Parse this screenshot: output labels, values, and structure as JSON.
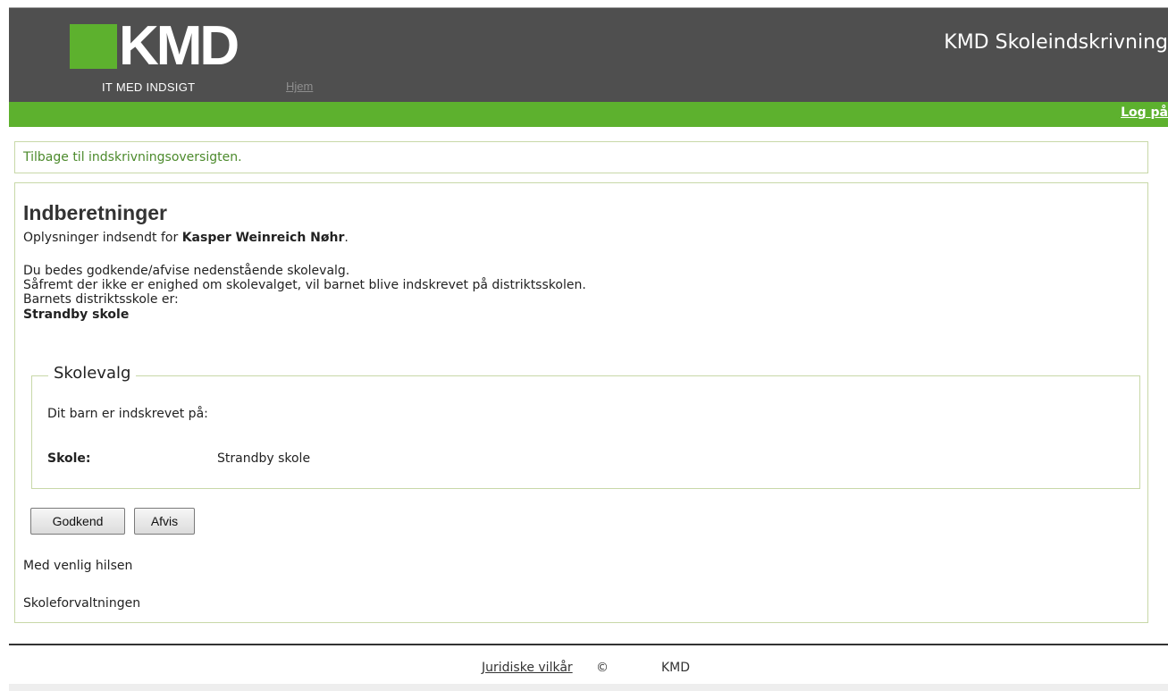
{
  "header": {
    "logo_text": "KMD",
    "logo_tagline": "IT MED INDSIGT",
    "nav_home": "Hjem",
    "app_title": "KMD Skoleindskrivning",
    "login": "Log på"
  },
  "back_link": "Tilbage til indskrivningsoversigten.",
  "main": {
    "title": "Indberetninger",
    "submitted_prefix": "Oplysninger indsendt for ",
    "child_name": "Kasper Weinreich Nøhr",
    "submitted_suffix": ".",
    "instruction_line1": "Du bedes godkende/afvise nedenstående skolevalg.",
    "instruction_line2": "Såfremt der ikke er enighed om skolevalget, vil barnet blive indskrevet på distriktsskolen.",
    "district_label": "Barnets distriktsskole er:",
    "district_school": "Strandby skole"
  },
  "school_choice": {
    "legend": "Skolevalg",
    "intro": "Dit barn er indskrevet på:",
    "school_label": "Skole:",
    "school_value": "Strandby skole"
  },
  "buttons": {
    "approve": "Godkend",
    "reject": "Afvis"
  },
  "signoff": {
    "greeting": "Med venlig hilsen",
    "sender": "Skoleforvaltningen"
  },
  "footer": {
    "legal_link": "Juridiske vilkår",
    "copyright": "©",
    "company": "KMD"
  },
  "colors": {
    "brand_green": "#5db12e",
    "header_gray": "#4f4f4f"
  }
}
